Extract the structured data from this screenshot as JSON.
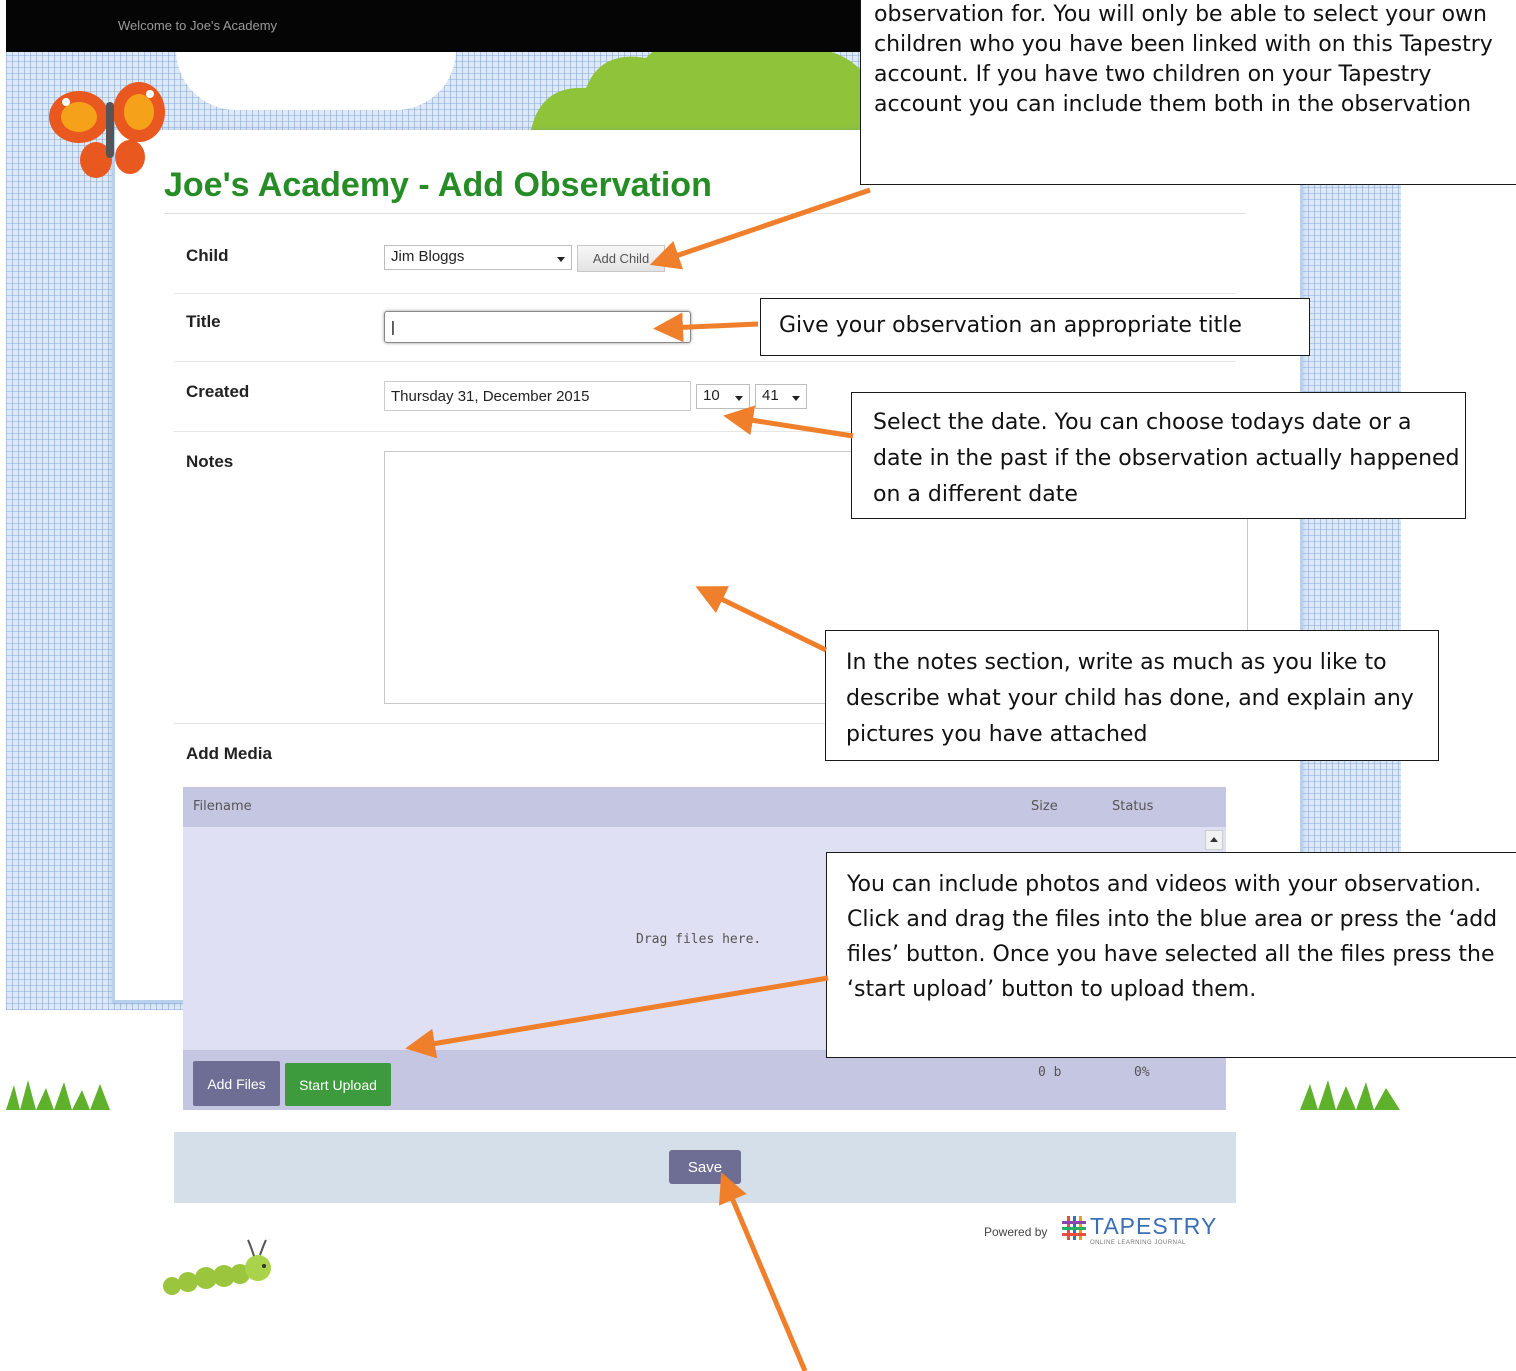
{
  "header": {
    "welcome": "Welcome to Joe's Academy"
  },
  "page": {
    "title": "Joe's Academy - Add Observation"
  },
  "form": {
    "child_label": "Child",
    "child_value": "Jim Bloggs",
    "add_child_label": "Add Child",
    "title_label": "Title",
    "title_value": "|",
    "created_label": "Created",
    "created_date": "Thursday 31, December 2015",
    "created_hour": "10",
    "created_minute": "41",
    "notes_label": "Notes",
    "add_media_label": "Add Media"
  },
  "uploader": {
    "columns": [
      "Filename",
      "Size",
      "Status"
    ],
    "drag_text": "Drag files here.",
    "add_files_label": "Add Files",
    "start_upload_label": "Start Upload",
    "total_size": "0 b",
    "total_status": "0%"
  },
  "footer": {
    "save_label": "Save",
    "powered_by": "Powered by",
    "brand_name": "TAPESTRY",
    "brand_tagline": "ONLINE LEARNING JOURNAL"
  },
  "callouts": {
    "child": "observation for. You will only be able to select your own children who you have been linked with on this Tapestry account. If you have two children on your Tapestry account you can include them both in the observation",
    "title": "Give your observation an appropriate title",
    "date": "Select the date. You can choose todays date or a date in the past if the observation actually happened on a different date",
    "notes": "In the notes section, write as much as you like to describe what your child has done, and explain any pictures you have attached",
    "media": "You can include photos and videos with your observation. Click and drag the files into the blue area or press the ‘add files’ button. Once you have selected all the files press the ‘start upload’ button to upload them."
  },
  "colors": {
    "title_green": "#268c26",
    "button_purple": "#6e6e95",
    "upload_green": "#3d9a3d",
    "arrow_orange": "#f07f2c",
    "uploader_bg": "#dfe0f3",
    "save_bar_bg": "#d5dfea"
  },
  "icons": [
    "butterfly-icon",
    "caterpillar-icon",
    "tapestry-logo-icon",
    "dropdown-caret-icon",
    "scroll-up-arrow-icon"
  ]
}
